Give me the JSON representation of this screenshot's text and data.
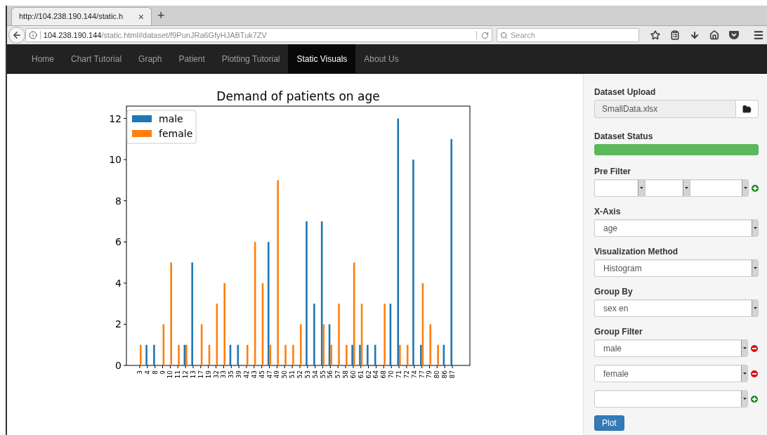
{
  "browser": {
    "tab_title": "http://104.238.190.144/static.h",
    "close_glyph": "×",
    "new_tab_glyph": "+",
    "url_host": "104.238.190.144",
    "url_path": "/static.html#dataset/f9PunJRa6GfyHJABTuk7ZV",
    "search_placeholder": "Search"
  },
  "nav": [
    {
      "label": "Home",
      "selected": false
    },
    {
      "label": "Chart Tutorial",
      "selected": false
    },
    {
      "label": "Graph",
      "selected": false
    },
    {
      "label": "Patient",
      "selected": false
    },
    {
      "label": "Plotting Tutorial",
      "selected": false
    },
    {
      "label": "Static Visuals",
      "selected": true
    },
    {
      "label": "About Us",
      "selected": false
    }
  ],
  "chart": {
    "chart_data": {
      "type": "bar",
      "title": "Demand of patients on age",
      "categories": [
        "3",
        "4",
        "8",
        "9",
        "10",
        "11",
        "12",
        "13",
        "17",
        "19",
        "32",
        "33",
        "35",
        "39",
        "42",
        "43",
        "45",
        "47",
        "49",
        "50",
        "51",
        "52",
        "53",
        "54",
        "55",
        "56",
        "57",
        "58",
        "60",
        "61",
        "62",
        "64",
        "68",
        "70",
        "71",
        "72",
        "74",
        "77",
        "79",
        "80",
        "86",
        "87"
      ],
      "series": [
        {
          "name": "male",
          "color": "#1f77b4",
          "values": [
            null,
            1,
            1,
            null,
            null,
            null,
            1,
            5,
            null,
            null,
            null,
            null,
            1,
            1,
            null,
            null,
            null,
            6,
            null,
            null,
            null,
            null,
            7,
            3,
            7,
            2,
            null,
            null,
            1,
            1,
            1,
            1,
            null,
            3,
            12,
            null,
            10,
            1,
            null,
            null,
            1,
            11
          ]
        },
        {
          "name": "female",
          "color": "#ff7f0e",
          "values": [
            1,
            null,
            null,
            2,
            5,
            1,
            1,
            null,
            2,
            1,
            3,
            4,
            null,
            null,
            1,
            6,
            4,
            1,
            9,
            1,
            1,
            2,
            null,
            null,
            2,
            1,
            3,
            1,
            5,
            3,
            null,
            null,
            3,
            null,
            1,
            1,
            null,
            4,
            2,
            1,
            null,
            null
          ]
        }
      ],
      "legend": "upper left",
      "ylim": [
        0,
        12.6
      ],
      "yticks": [
        0,
        2,
        4,
        6,
        8,
        10,
        12
      ]
    }
  },
  "sidebar": {
    "dataset_upload": {
      "label": "Dataset Upload",
      "value": "SmallData.xlsx"
    },
    "dataset_status": {
      "label": "Dataset Status",
      "level": 1
    },
    "pre_filter": {
      "label": "Pre Filter"
    },
    "x_axis": {
      "label": "X-Axis",
      "value": "age"
    },
    "visualization_method": {
      "label": "Visualization Method",
      "value": "Histogram"
    },
    "group_by": {
      "label": "Group By",
      "value": "sex  en"
    },
    "group_filter": {
      "label": "Group Filter",
      "rows": [
        {
          "kind": "remove",
          "value": "male"
        },
        {
          "kind": "remove",
          "value": "female"
        },
        {
          "kind": "add"
        }
      ]
    },
    "plot_button": "Plot"
  }
}
